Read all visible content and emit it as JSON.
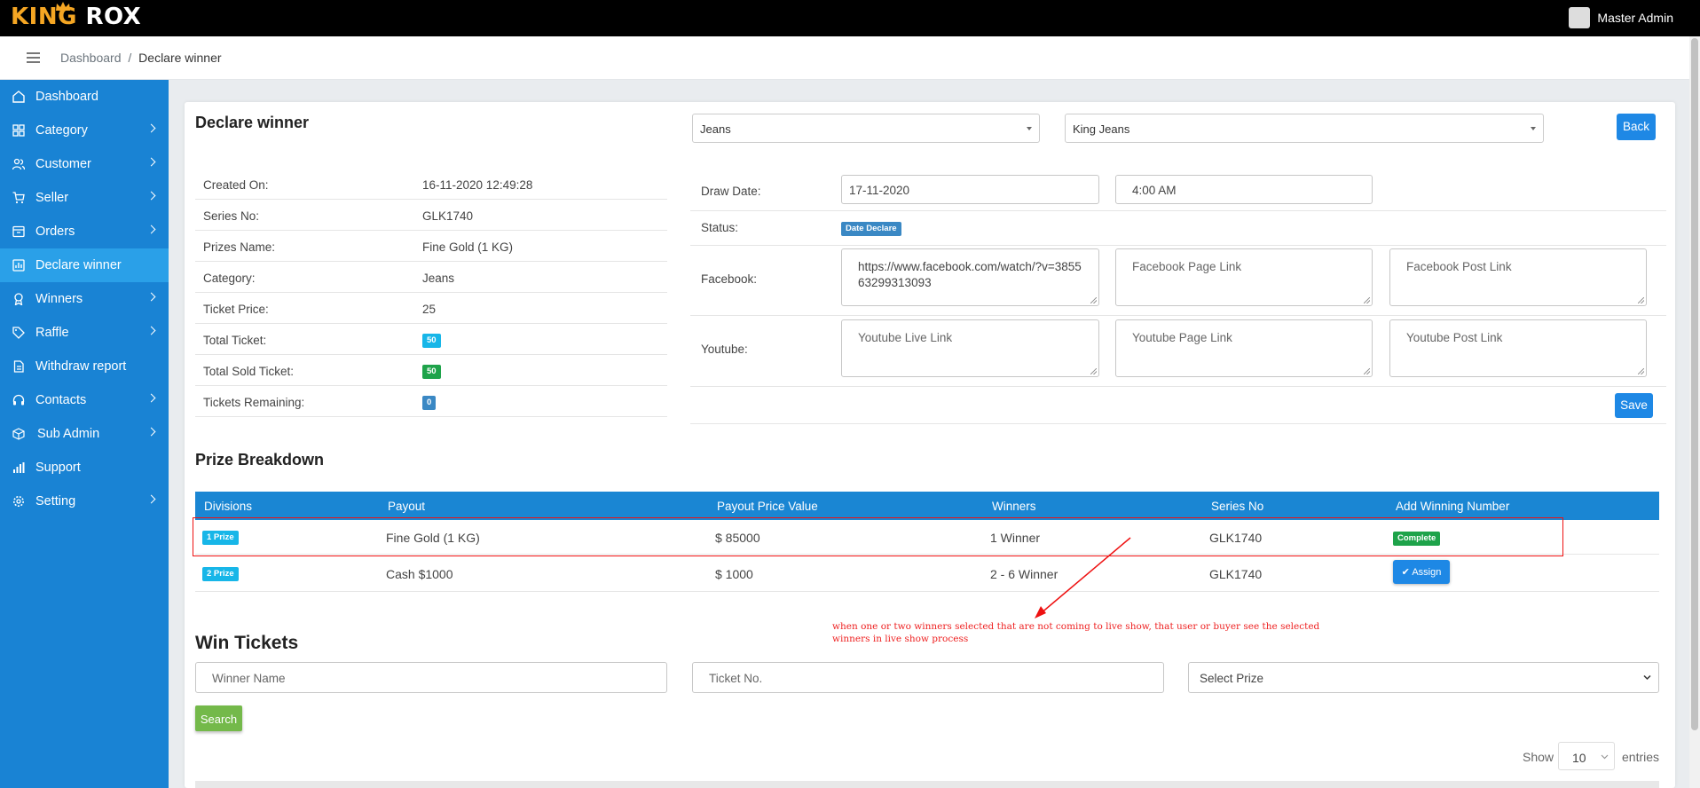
{
  "app": {
    "logo_left": "KING",
    "logo_right": "ROX",
    "user_name": "Master Admin",
    "accent": "#1983d4"
  },
  "breadcrumb": {
    "root": "Dashboard",
    "sep": "/",
    "current": "Declare winner"
  },
  "sidebar": {
    "items": [
      {
        "label": "Dashboard",
        "icon": "home-icon",
        "arrow": false
      },
      {
        "label": "Category",
        "icon": "grid-icon",
        "arrow": true
      },
      {
        "label": "Customer",
        "icon": "users-icon",
        "arrow": true
      },
      {
        "label": "Seller",
        "icon": "cart-icon",
        "arrow": true
      },
      {
        "label": "Orders",
        "icon": "box-icon",
        "arrow": true
      },
      {
        "label": "Declare winner",
        "icon": "chart-icon",
        "arrow": false,
        "active": true
      },
      {
        "label": "Winners",
        "icon": "award-icon",
        "arrow": true
      },
      {
        "label": "Raffle",
        "icon": "tag-icon",
        "arrow": true
      },
      {
        "label": "Withdraw report",
        "icon": "file-icon",
        "arrow": false
      },
      {
        "label": "Contacts",
        "icon": "headset-icon",
        "arrow": true
      },
      {
        "label": "Sub Admin",
        "icon": "cube-icon",
        "arrow": true
      },
      {
        "label": "Support",
        "icon": "bars-icon",
        "arrow": false
      },
      {
        "label": "Setting",
        "icon": "gear-icon",
        "arrow": true
      }
    ]
  },
  "page": {
    "title": "Declare winner",
    "category_select": "Jeans",
    "product_select": "King Jeans",
    "back_label": "Back",
    "save_label": "Save"
  },
  "details": {
    "created_on": {
      "label": "Created On:",
      "value": "16-11-2020 12:49:28"
    },
    "series_no": {
      "label": "Series No:",
      "value": "GLK1740"
    },
    "prizes_name": {
      "label": "Prizes Name:",
      "value": "Fine Gold (1 KG)"
    },
    "category": {
      "label": "Category:",
      "value": "Jeans"
    },
    "ticket_price": {
      "label": "Ticket Price:",
      "value": "25"
    },
    "total_ticket": {
      "label": "Total Ticket:",
      "value": "50"
    },
    "total_sold": {
      "label": "Total Sold Ticket:",
      "value": "50"
    },
    "remaining": {
      "label": "Tickets Remaining:",
      "value": "0"
    }
  },
  "draw": {
    "draw_date_label": "Draw Date:",
    "draw_date": "17-11-2020",
    "draw_time": "4:00 AM",
    "status_label": "Status:",
    "status_badge": "Date Declare",
    "facebook_label": "Facebook:",
    "facebook_live": "https://www.facebook.com/watch/?v=385563299313093",
    "facebook_page_ph": "Facebook Page Link",
    "facebook_post_ph": "Facebook Post Link",
    "youtube_label": "Youtube:",
    "youtube_live_ph": "Youtube Live Link",
    "youtube_page_ph": "Youtube Page Link",
    "youtube_post_ph": "Youtube Post Link"
  },
  "prize_breakdown": {
    "title": "Prize Breakdown",
    "headers": [
      "Divisions",
      "Payout",
      "Payout Price Value",
      "Winners",
      "Series No",
      "Add Winning Number"
    ],
    "rows": [
      {
        "division": "1 Prize",
        "payout": "Fine Gold (1 KG)",
        "value": "$ 85000",
        "winners": "1 Winner",
        "series": "GLK1740",
        "action": "Complete"
      },
      {
        "division": "2 Prize",
        "payout": "Cash $1000",
        "value": "$ 1000",
        "winners": "2 - 6 Winner",
        "series": "GLK1740",
        "action": "Assign"
      }
    ]
  },
  "win_tickets": {
    "title": "Win Tickets",
    "winner_ph": "Winner Name",
    "ticket_ph": "Ticket No.",
    "prize_select": "Select Prize",
    "search_label": "Search",
    "show_label": "Show",
    "show_value": "10",
    "entries_label": "entries"
  },
  "annotation": {
    "note": "when one or two winners selected that are not coming to live show, that user or buyer see the selected winners in live show process"
  }
}
